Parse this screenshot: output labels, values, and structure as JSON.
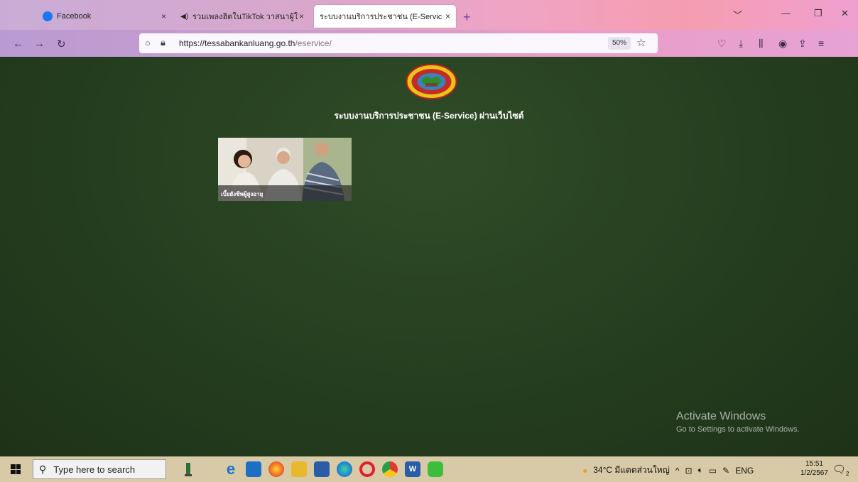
{
  "browser": {
    "tabs": [
      {
        "title": "Facebook",
        "active": false
      },
      {
        "title": "รวมเพลงฮิตในTikTok วาสนาผู้ใด",
        "active": false
      },
      {
        "title": "ระบบงานบริการประชาชน (E-Service)",
        "active": true
      }
    ],
    "tab_close": "×",
    "new_tab": "+",
    "url_host": "https://tessabankanluang.go.th",
    "url_path": "/eservice/",
    "zoom": "50%"
  },
  "page": {
    "heading": "ระบบงานบริการประชาชน (E-Service) ผ่านเว็บไซต์",
    "card_caption": "เบี้ยยังชีพผู้สูงอายุ"
  },
  "watermark": {
    "line1": "Activate Windows",
    "line2": "Go to Settings to activate Windows."
  },
  "taskbar": {
    "search_placeholder": "Type here to search",
    "weather": "34°C  มีแดดส่วนใหญ่",
    "language": "ENG",
    "time": "15:51",
    "date": "1/2/2567",
    "notification_count": "2"
  },
  "colors": {
    "page_bg": "#263f20",
    "accent": "#6b3fa0"
  }
}
